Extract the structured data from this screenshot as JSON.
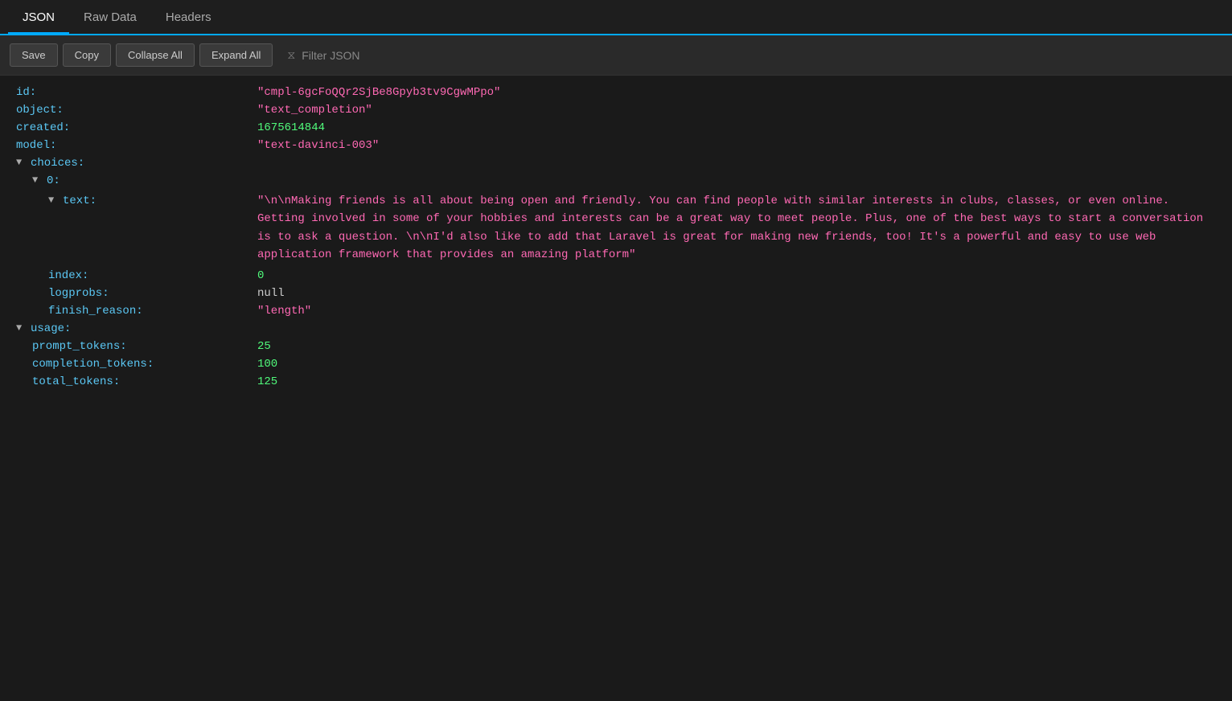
{
  "tabs": [
    {
      "id": "json",
      "label": "JSON",
      "active": true
    },
    {
      "id": "raw-data",
      "label": "Raw Data",
      "active": false
    },
    {
      "id": "headers",
      "label": "Headers",
      "active": false
    }
  ],
  "toolbar": {
    "save_label": "Save",
    "copy_label": "Copy",
    "collapse_all_label": "Collapse All",
    "expand_all_label": "Expand All",
    "filter_placeholder": "Filter JSON"
  },
  "json": {
    "id_key": "id:",
    "id_val": "\"cmpl-6gcFoQQr2SjBe8Gpyb3tv9CgwMPpo\"",
    "object_key": "object:",
    "object_val": "\"text_completion\"",
    "created_key": "created:",
    "created_val": "1675614844",
    "model_key": "model:",
    "model_val": "\"text-davinci-003\"",
    "choices_key": "choices:",
    "choice_index_key": "0:",
    "text_key": "text:",
    "text_val": "\"\\n\\nMaking friends is all about being open and friendly. You can find people with similar interests in clubs, classes, or even online. Getting involved in some of your hobbies and interests can be a great way to meet people. Plus, one of the best ways to start a conversation is to ask a question. \\n\\nI'd also like to add that Laravel is great for making new friends, too! It's a powerful and easy to use web application framework that provides an amazing platform\"",
    "index_key": "index:",
    "index_val": "0",
    "logprobs_key": "logprobs:",
    "logprobs_val": "null",
    "finish_reason_key": "finish_reason:",
    "finish_reason_val": "\"length\"",
    "usage_key": "usage:",
    "prompt_tokens_key": "prompt_tokens:",
    "prompt_tokens_val": "25",
    "completion_tokens_key": "completion_tokens:",
    "completion_tokens_val": "100",
    "total_tokens_key": "total_tokens:",
    "total_tokens_val": "125"
  }
}
